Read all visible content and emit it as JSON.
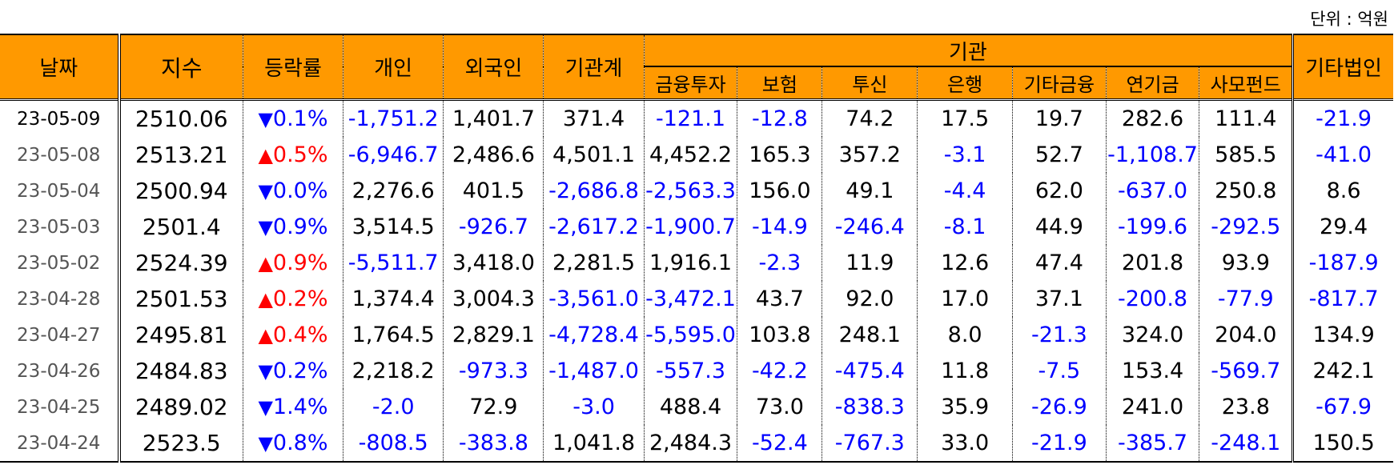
{
  "unit_label": "단위 : 억원",
  "headers": {
    "date": "날짜",
    "index": "지수",
    "change": "등락률",
    "individual": "개인",
    "foreign": "외국인",
    "institution_total": "기관계",
    "institution": "기관",
    "institution_sub": [
      "금융투자",
      "보험",
      "투신",
      "은행",
      "기타금융",
      "연기금",
      "사모펀드"
    ],
    "other_corp": "기타법인"
  },
  "rows": [
    {
      "date": "23-05-09",
      "index": "2510.06",
      "dir": "down",
      "change": "0.1%",
      "vals": [
        "-1,751.2",
        "1,401.7",
        "371.4",
        "-121.1",
        "-12.8",
        "74.2",
        "17.5",
        "19.7",
        "282.6",
        "111.4",
        "-21.9"
      ]
    },
    {
      "date": "23-05-08",
      "index": "2513.21",
      "dir": "up",
      "change": "0.5%",
      "vals": [
        "-6,946.7",
        "2,486.6",
        "4,501.1",
        "4,452.2",
        "165.3",
        "357.2",
        "-3.1",
        "52.7",
        "-1,108.7",
        "585.5",
        "-41.0"
      ]
    },
    {
      "date": "23-05-04",
      "index": "2500.94",
      "dir": "down",
      "change": "0.0%",
      "vals": [
        "2,276.6",
        "401.5",
        "-2,686.8",
        "-2,563.3",
        "156.0",
        "49.1",
        "-4.4",
        "62.0",
        "-637.0",
        "250.8",
        "8.6"
      ]
    },
    {
      "date": "23-05-03",
      "index": "2501.4",
      "dir": "down",
      "change": "0.9%",
      "vals": [
        "3,514.5",
        "-926.7",
        "-2,617.2",
        "-1,900.7",
        "-14.9",
        "-246.4",
        "-8.1",
        "44.9",
        "-199.6",
        "-292.5",
        "29.4"
      ]
    },
    {
      "date": "23-05-02",
      "index": "2524.39",
      "dir": "up",
      "change": "0.9%",
      "vals": [
        "-5,511.7",
        "3,418.0",
        "2,281.5",
        "1,916.1",
        "-2.3",
        "11.9",
        "12.6",
        "47.4",
        "201.8",
        "93.9",
        "-187.9"
      ]
    },
    {
      "date": "23-04-28",
      "index": "2501.53",
      "dir": "up",
      "change": "0.2%",
      "vals": [
        "1,374.4",
        "3,004.3",
        "-3,561.0",
        "-3,472.1",
        "43.7",
        "92.0",
        "17.0",
        "37.1",
        "-200.8",
        "-77.9",
        "-817.7"
      ]
    },
    {
      "date": "23-04-27",
      "index": "2495.81",
      "dir": "up",
      "change": "0.4%",
      "vals": [
        "1,764.5",
        "2,829.1",
        "-4,728.4",
        "-5,595.0",
        "103.8",
        "248.1",
        "8.0",
        "-21.3",
        "324.0",
        "204.0",
        "134.9"
      ]
    },
    {
      "date": "23-04-26",
      "index": "2484.83",
      "dir": "down",
      "change": "0.2%",
      "vals": [
        "2,218.2",
        "-973.3",
        "-1,487.0",
        "-557.3",
        "-42.2",
        "-475.4",
        "11.8",
        "-7.5",
        "153.4",
        "-569.7",
        "242.1"
      ]
    },
    {
      "date": "23-04-25",
      "index": "2489.02",
      "dir": "down",
      "change": "1.4%",
      "vals": [
        "-2.0",
        "72.9",
        "-3.0",
        "488.4",
        "73.0",
        "-838.3",
        "35.9",
        "-26.9",
        "241.0",
        "23.8",
        "-67.9"
      ]
    },
    {
      "date": "23-04-24",
      "index": "2523.5",
      "dir": "down",
      "change": "0.8%",
      "vals": [
        "-808.5",
        "-383.8",
        "1,041.8",
        "2,484.3",
        "-52.4",
        "-767.3",
        "33.0",
        "-21.9",
        "-385.7",
        "-248.1",
        "150.5"
      ]
    }
  ],
  "colors": {
    "header_bg": "#ff9900",
    "negative": "#0000ff",
    "up": "#ff0000",
    "down": "#0000ff"
  },
  "icons": {
    "up": "up-triangle-icon",
    "down": "down-triangle-icon"
  }
}
